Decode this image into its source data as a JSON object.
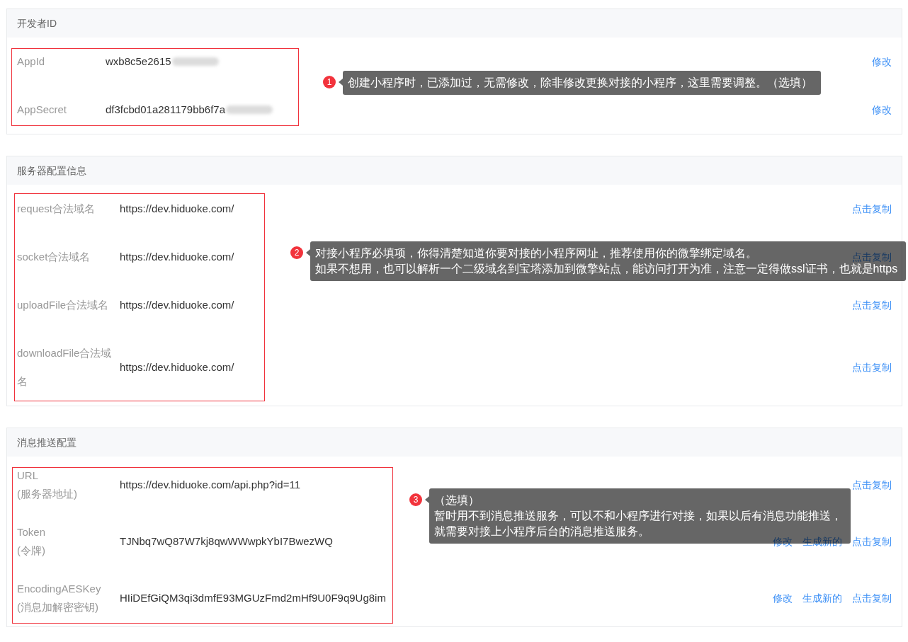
{
  "sections": [
    {
      "title": "开发者ID",
      "highlight": true,
      "annotation": {
        "badge": "1",
        "lines": [
          "创建小程序时，已添加过，无需修改，除非修改更换对接的小程序，这里需要调整。（选填）"
        ]
      },
      "rows": [
        {
          "label": "AppId",
          "value": "wxb8c5e2615",
          "redacted": true,
          "actions": [
            "修改"
          ]
        },
        {
          "label": "AppSecret",
          "value": "df3fcbd01a281179bb6f7a",
          "redacted": true,
          "actions": [
            "修改"
          ]
        }
      ]
    },
    {
      "title": "服务器配置信息",
      "highlight": true,
      "annotation": {
        "badge": "2",
        "lines": [
          "对接小程序必填项，你得清楚知道你要对接的小程序网址，推荐使用你的微擎绑定域名。",
          "如果不想用，也可以解析一个二级域名到宝塔添加到微擎站点，能访问打开为准，注意一定得做ssl证书，也就是https"
        ]
      },
      "rows": [
        {
          "label": "request合法域名",
          "value": "https://dev.hiduoke.com/",
          "actions": [
            "点击复制"
          ]
        },
        {
          "label": "socket合法域名",
          "value": "https://dev.hiduoke.com/",
          "actions": [
            "点击复制"
          ]
        },
        {
          "label": "uploadFile合法域名",
          "value": "https://dev.hiduoke.com/",
          "actions": [
            "点击复制"
          ]
        },
        {
          "label": "downloadFile合法域名",
          "value": "https://dev.hiduoke.com/",
          "actions": [
            "点击复制"
          ]
        }
      ]
    },
    {
      "title": "消息推送配置",
      "highlight": true,
      "annotation": {
        "badge": "3",
        "lines": [
          "（选填）",
          "暂时用不到消息推送服务，可以不和小程序进行对接，如果以后有消息功能推送，",
          "就需要对接上小程序后台的消息推送服务。"
        ]
      },
      "rows": [
        {
          "label": "URL",
          "note": "(服务器地址)",
          "value": "https://dev.hiduoke.com/api.php?id=11",
          "actions": [
            "点击复制"
          ]
        },
        {
          "label": "Token",
          "note": "(令牌)",
          "value": "TJNbq7wQ87W7kj8qwWWwpkYbI7BwezWQ",
          "actions": [
            "修改",
            "生成新的",
            "点击复制"
          ]
        },
        {
          "label": "EncodingAESKey",
          "note": "(消息加解密密钥)",
          "value": "HIiDEfGiQM3qi3dmfE93MGUzFmd2mHf9U0F9q9Ug8im",
          "actions": [
            "修改",
            "生成新的",
            "点击复制"
          ]
        }
      ]
    }
  ]
}
